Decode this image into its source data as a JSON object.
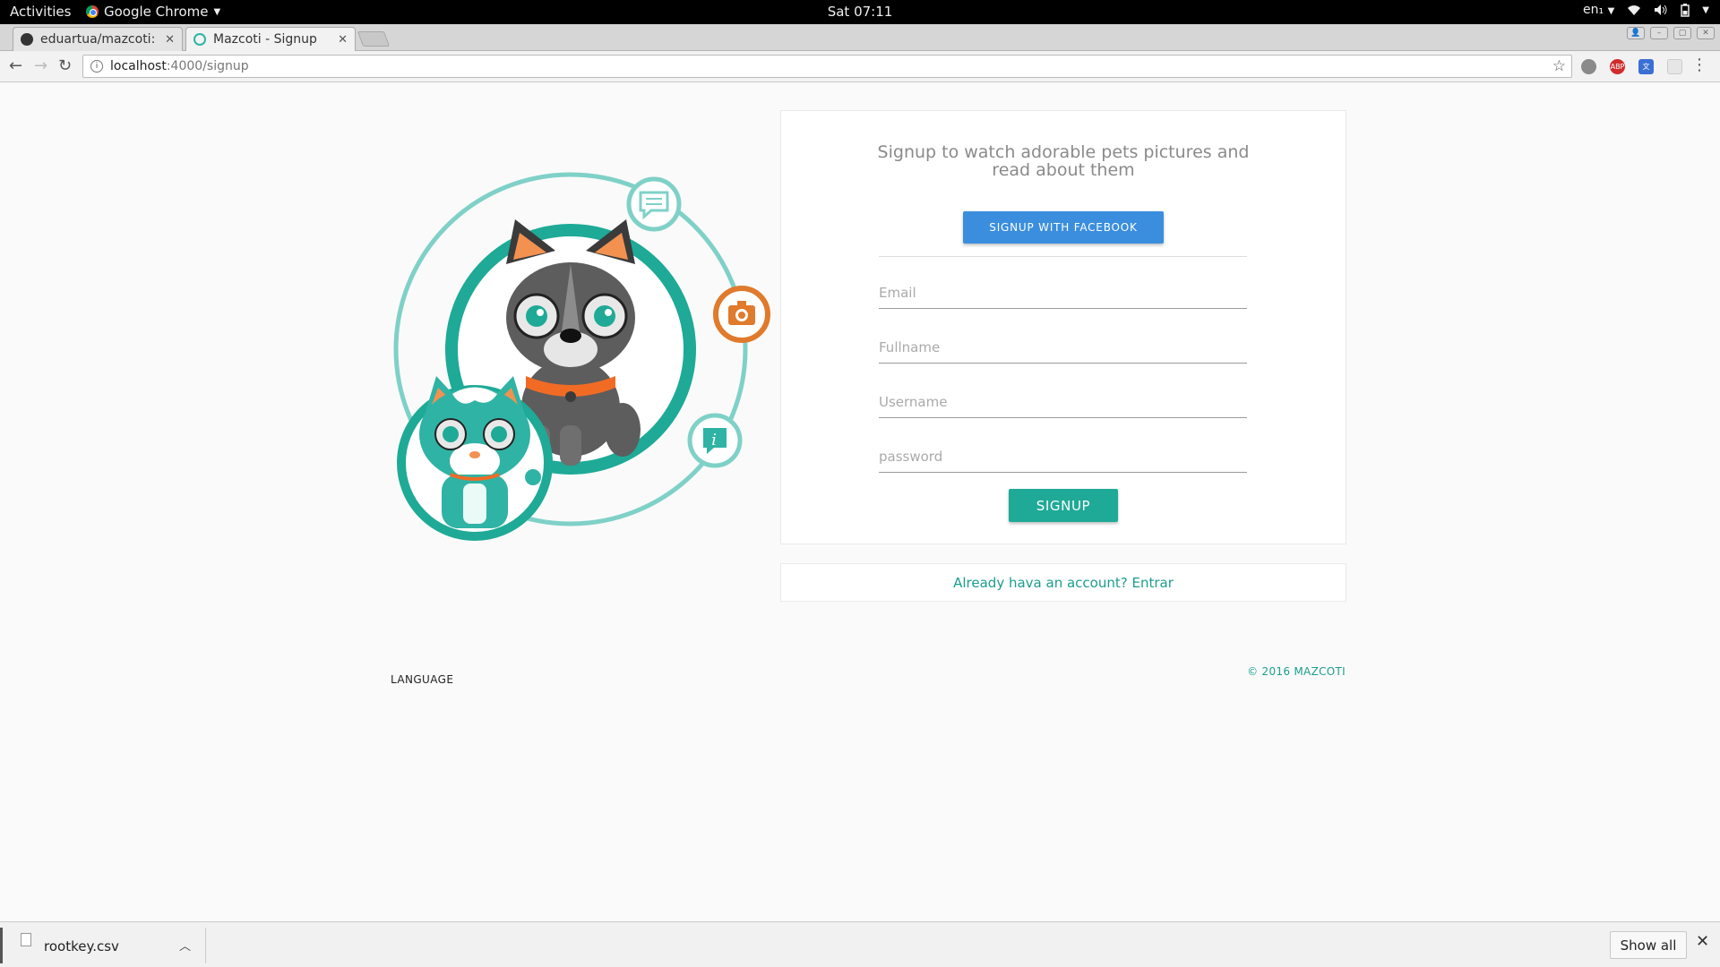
{
  "os_bar": {
    "activities": "Activities",
    "app_name": "Google Chrome",
    "clock": "Sat 07:11",
    "keyboard_layout": "en₁"
  },
  "browser": {
    "tabs": [
      {
        "title": "eduartua/mazcoti: S",
        "favicon": "github-icon",
        "active": false
      },
      {
        "title": "Mazcoti - Signup",
        "favicon": "mazcoti-icon",
        "active": true
      }
    ],
    "url_host": "localhost",
    "url_path": ":4000/signup",
    "extensions": [
      "ghostery-icon",
      "adblock-plus-icon",
      "google-translate-icon",
      "extension-icon"
    ]
  },
  "page": {
    "heading": "Signup to watch adorable pets pictures and read about them",
    "facebook_button": "SIGNUP WITH FACEBOOK",
    "fields": {
      "email_placeholder": "Email",
      "fullname_placeholder": "Fullname",
      "username_placeholder": "Username",
      "password_placeholder": "password"
    },
    "signup_button": "SIGNUP",
    "login_prompt": "Already hava an account? Entrar",
    "language_label": "LANGUAGE",
    "copyright": "© 2016 MAZCOTI"
  },
  "download_shelf": {
    "file_name": "rootkey.csv",
    "show_all": "Show all"
  },
  "colors": {
    "teal": "#1eaa96",
    "facebook_blue": "#3b8ede",
    "camera_orange": "#e07a2c"
  }
}
